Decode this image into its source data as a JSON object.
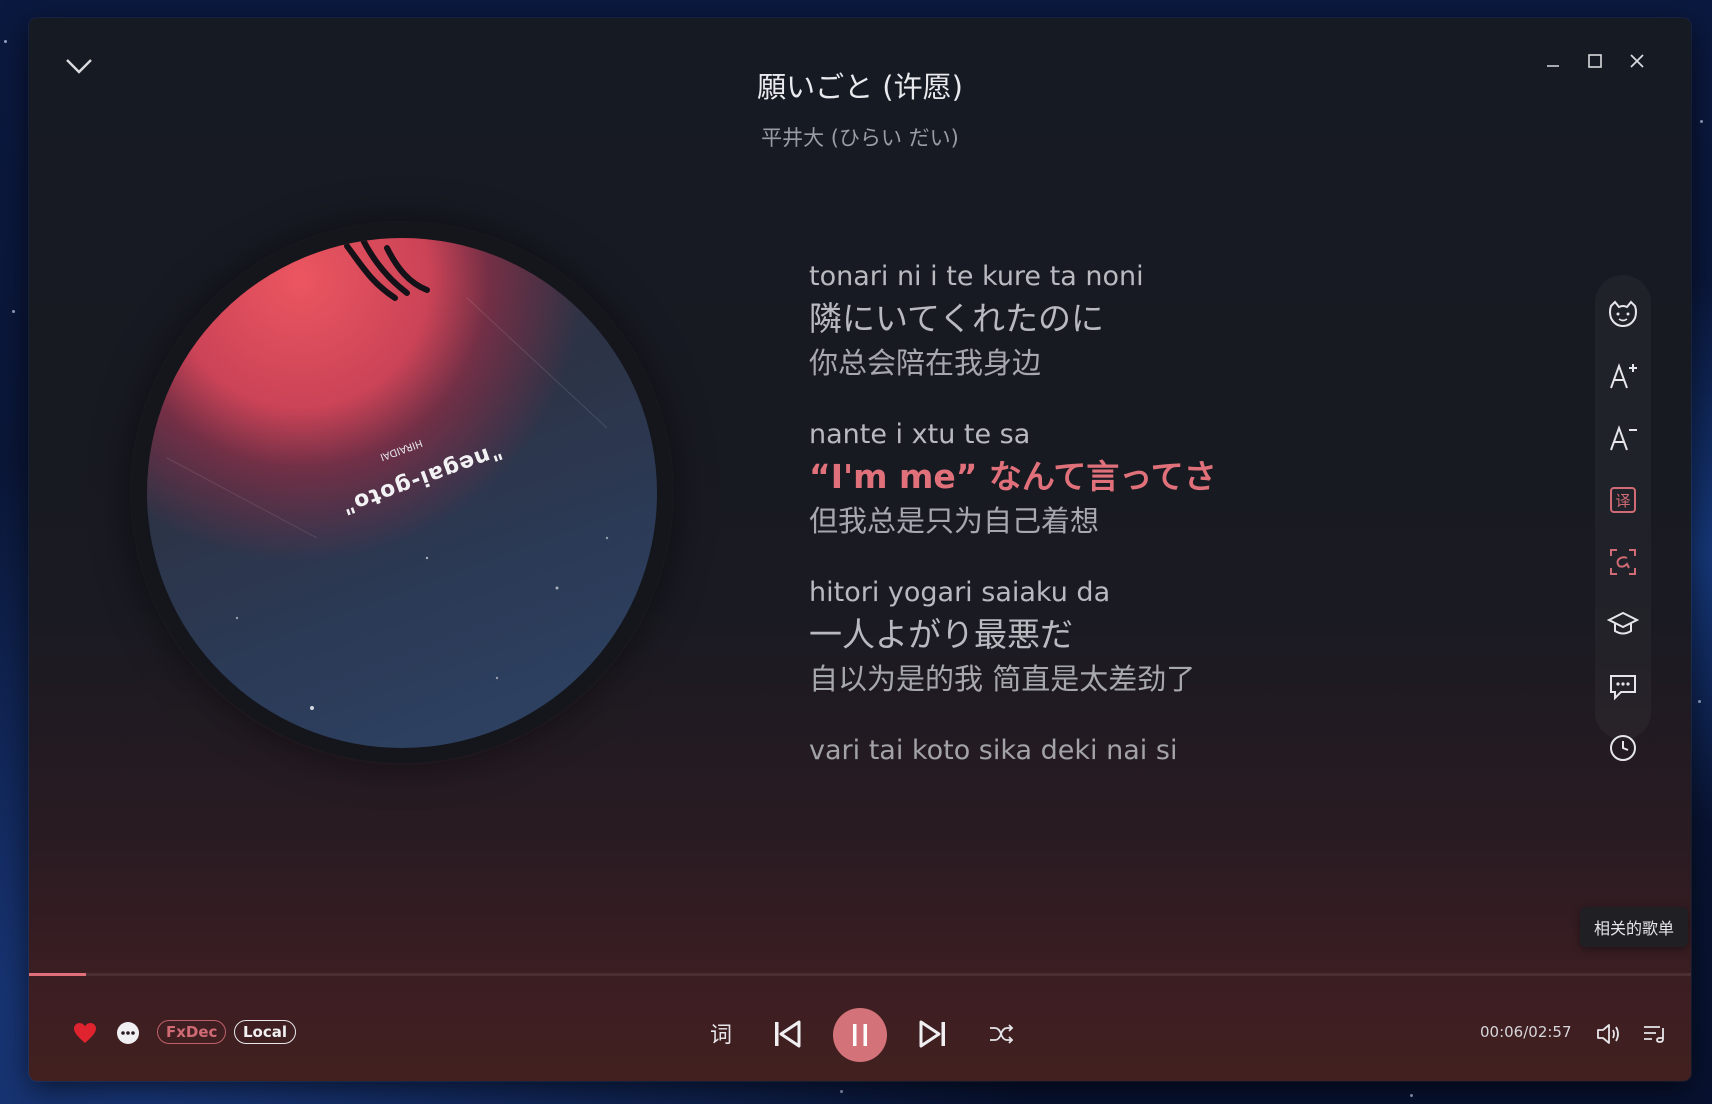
{
  "window": {
    "title": "願いごと (许愿)",
    "artist": "平井大 (ひらい だい)"
  },
  "album_art": {
    "title_text": "\"negai-goto\"",
    "artist_text": "HIRAIDAI"
  },
  "lyrics": [
    {
      "romaji": "tonari ni i te kure ta noni",
      "japanese": "隣にいてくれたのに",
      "chinese": "你总会陪在我身边",
      "active": false
    },
    {
      "romaji": "nante i xtu te sa",
      "japanese": "“I'm me” なんて言ってさ",
      "chinese": "但我总是只为自己着想",
      "active": true
    },
    {
      "romaji": "hitori yogari saiaku da",
      "japanese": "一人よがり最悪だ",
      "chinese": "自以为是的我 简直是太差劲了",
      "active": false
    },
    {
      "romaji": "vari tai koto sika deki nai si",
      "japanese": "",
      "chinese": "",
      "active": false
    }
  ],
  "side_tools": [
    {
      "icon": "cat-face-icon"
    },
    {
      "icon": "font-increase-icon"
    },
    {
      "icon": "font-decrease-icon"
    },
    {
      "icon": "translate-icon",
      "label": "译"
    },
    {
      "icon": "romaji-icon"
    },
    {
      "icon": "learn-cap-icon"
    },
    {
      "icon": "comments-icon"
    },
    {
      "icon": "history-clock-icon"
    }
  ],
  "tooltip": "相关的歌单",
  "playback": {
    "progress": 0.034,
    "time": "00:06/02:57",
    "liked": true
  },
  "tags": {
    "fxdec": "FxDec",
    "local": "Local"
  },
  "controls": {
    "lyrics_label": "词"
  },
  "colors": {
    "accent": "#e0717a",
    "like": "#e0242f",
    "text_primary": "#e9eaee",
    "text_secondary": "#9a9ca4"
  }
}
